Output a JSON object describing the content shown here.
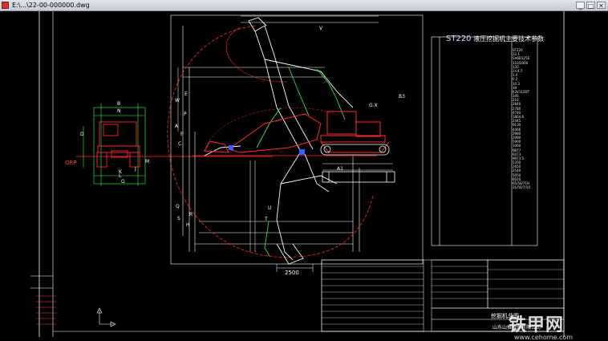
{
  "window": {
    "title": "E:\\...\\22-00-000000.dwg",
    "btn_min": "_",
    "btn_max": "□",
    "btn_close": "✕"
  },
  "drawing": {
    "table_title": "ST220",
    "table_subtitle": "液压挖掘机主要技术参数",
    "grp_label": "GRP",
    "dim_labels": [
      "V",
      "W",
      "D",
      "A",
      "B",
      "C",
      "E",
      "F",
      "G",
      "H",
      "J",
      "K",
      "L",
      "M",
      "N",
      "P",
      "Q",
      "R",
      "S",
      "T",
      "U",
      "G.X",
      "A1",
      "B3"
    ],
    "dim_2500": "2500",
    "spec_values": [
      "ST220",
      "22.1",
      "SA6D125E",
      "110/2000",
      "120",
      "2×4.7",
      "1.0",
      "0.2",
      "34.3",
      "39",
      "K3V112DT",
      "346",
      "216",
      "2840",
      "2780",
      "4740",
      "1864.6",
      "2445",
      "9130",
      "4466",
      "2980",
      "2090",
      "5900",
      "1060",
      "9877",
      "6473",
      "9973.5",
      "5350",
      "2650",
      "2540",
      "5050",
      "6020",
      "65/50/71H",
      "31/50/7/10"
    ],
    "bottom_title": "挖掘机总图",
    "bottom_company": "山东山推股份有限公司"
  },
  "watermark": {
    "brand": "铁甲网",
    "url": "www.cehome.com"
  },
  "colors": {
    "background": "#000000",
    "red": "#ff2a2a",
    "green": "#2dff4a",
    "white": "#ffffff",
    "blue": "#3a5bff",
    "cyan": "#00ffff"
  }
}
